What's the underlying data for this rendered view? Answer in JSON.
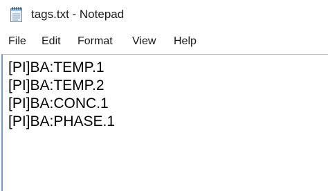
{
  "window": {
    "title": "tags.txt - Notepad",
    "icon": "notepad-icon"
  },
  "menu": {
    "items": [
      {
        "label": "File"
      },
      {
        "label": "Edit"
      },
      {
        "label": "Format"
      },
      {
        "label": "View"
      },
      {
        "label": "Help"
      }
    ]
  },
  "editor": {
    "lines": [
      "[PI]BA:TEMP.1",
      "[PI]BA:TEMP.2",
      "[PI]BA:CONC.1",
      "[PI]BA:PHASE.1"
    ]
  },
  "colors": {
    "background": "#ffffff",
    "text": "#000000",
    "focus_border": "#6f9ad8"
  }
}
